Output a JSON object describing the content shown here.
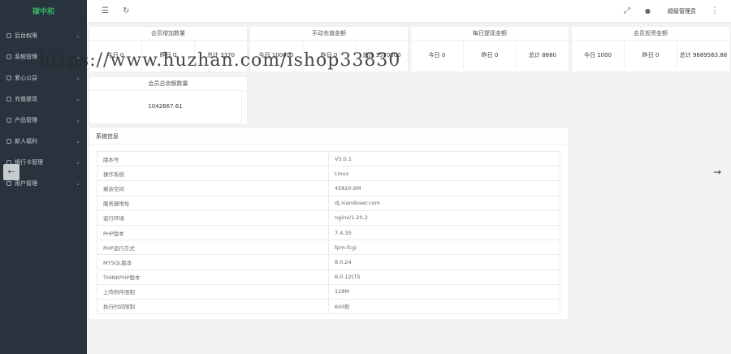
{
  "sidebar": {
    "logo": "碳中和",
    "items": [
      {
        "label": "后台权限",
        "icon": "user-icon",
        "arrow": "⌄"
      },
      {
        "label": "系统管理",
        "icon": "gear-icon",
        "arrow": "⌄"
      },
      {
        "label": "爱心公益",
        "icon": "heart-icon",
        "arrow": "⌄"
      },
      {
        "label": "充值提现",
        "icon": "wallet-icon",
        "arrow": "⌄"
      },
      {
        "label": "产品管理",
        "icon": "box-icon",
        "arrow": "⌄"
      },
      {
        "label": "新人福利",
        "icon": "gift-icon",
        "arrow": "⌄"
      },
      {
        "label": "银行卡管理",
        "icon": "card-icon",
        "arrow": "⌄"
      },
      {
        "label": "用户管理",
        "icon": "users-icon",
        "arrow": "⌄"
      }
    ]
  },
  "header": {
    "menu_icon": "☰",
    "refresh_icon": "↻",
    "fullscreen_icon": "⤢",
    "theme_icon": "●",
    "user": "超级管理员",
    "more_icon": "⋮"
  },
  "stats": [
    {
      "title": "会员增加数量",
      "today": "今日 0",
      "yesterday": "昨日 0",
      "total": "总计 3370"
    },
    {
      "title": "手动充值金额",
      "today": "今日 100000",
      "yesterday": "昨日 0",
      "total": "总计 3570000"
    },
    {
      "title": "每日提现金额",
      "today": "今日 0",
      "yesterday": "昨日 0",
      "total": "总计 8880"
    },
    {
      "title": "会员投资金额",
      "today": "今日 1000",
      "yesterday": "昨日 0",
      "total": "总计 9689563.88"
    }
  ],
  "balance": {
    "title": "会员总余额数量",
    "value": "1042667.61"
  },
  "system": {
    "title": "系统信息",
    "rows": [
      {
        "k": "版本号",
        "v": "V5.0.1"
      },
      {
        "k": "操作系统",
        "v": "Linux"
      },
      {
        "k": "剩余空间",
        "v": "45820.6M"
      },
      {
        "k": "服务器地址",
        "v": "dj.xiandoaer.com"
      },
      {
        "k": "运行环境",
        "v": "nginx/1.20.2"
      },
      {
        "k": "PHP版本",
        "v": "7.4.30"
      },
      {
        "k": "PHP运行方式",
        "v": "fpm-fcgi"
      },
      {
        "k": "MYSQL版本",
        "v": "8.0.24"
      },
      {
        "k": "THINKPHP版本",
        "v": "6.0.12LTS"
      },
      {
        "k": "上传附件限制",
        "v": "128M"
      },
      {
        "k": "执行时间限制",
        "v": "600秒"
      }
    ]
  },
  "watermark": "https://www.huzhan.com/ishop33830",
  "nav": {
    "prev": "←",
    "next": "→"
  }
}
